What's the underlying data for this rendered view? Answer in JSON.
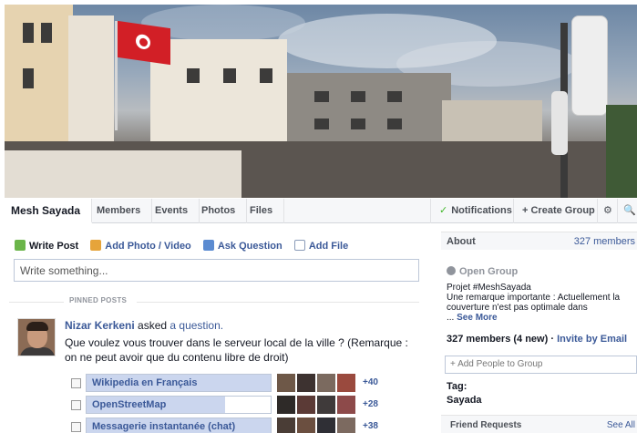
{
  "tabs": {
    "group_name": "Mesh Sayada",
    "items": [
      "Members",
      "Events",
      "Photos",
      "Files"
    ],
    "notifications": "Notifications",
    "create_group": "+ Create Group",
    "gear_icon": "gear-icon",
    "search_icon": "search-icon"
  },
  "composer": {
    "write_post": "Write Post",
    "add_photo": "Add Photo / Video",
    "ask_question": "Ask Question",
    "add_file": "Add File",
    "placeholder": "Write something..."
  },
  "pinned": {
    "label": "PINNED POSTS"
  },
  "post": {
    "author": "Nizar Kerkeni",
    "action": " asked ",
    "object": "a question.",
    "question": "Que voulez vous trouver dans le serveur local de la ville ? (Remarque : on ne peut avoir que du contenu libre de droit)",
    "options": [
      {
        "label": "Wikipedia en Français",
        "fill": 1.0,
        "more": "+40"
      },
      {
        "label": "OpenStreetMap",
        "fill": 0.75,
        "more": "+28"
      },
      {
        "label": "Messagerie instantanée (chat)",
        "fill": 1.0,
        "more": "+38"
      }
    ]
  },
  "about": {
    "title": "About",
    "members_link": "327 members",
    "privacy": "Open Group",
    "desc_1": "Projet #MeshSayada",
    "desc_2": "Une remarque importante : Actuellement la couverture n'est pas optimale dans",
    "desc_3": "... ",
    "see_more": "See More",
    "members_count": "327 members (4 new)",
    "invite_sep": " · ",
    "invite": "Invite by Email",
    "add_people": "+ Add People to Group",
    "tag_label": "Tag:",
    "tag_value": "Sayada"
  },
  "friend_requests": {
    "title": "Friend Requests",
    "see_all": "See All"
  },
  "colors": {
    "link": "#3b5998",
    "flag": "#d21f26",
    "check": "#42b72a"
  }
}
